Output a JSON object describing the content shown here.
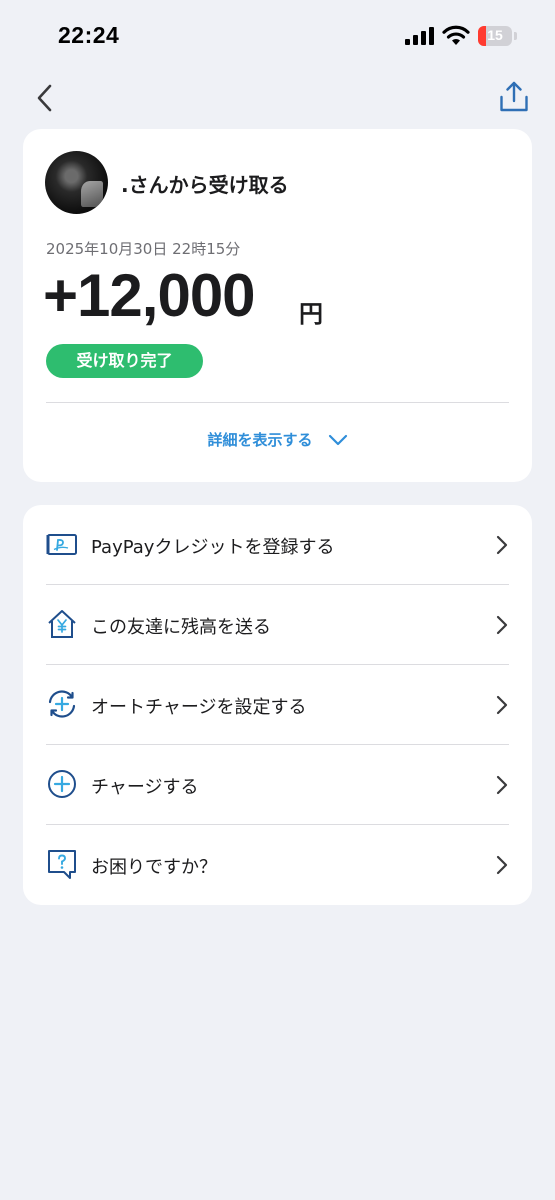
{
  "status_bar": {
    "time": "22:24",
    "battery_level": "15",
    "battery_color": "#ff3b30"
  },
  "nav": {
    "back_icon": "chevron-left-icon",
    "share_icon": "share-icon"
  },
  "transaction": {
    "title": ".さんから受け取る",
    "datetime": "2025年10月30日 22時15分",
    "amount": "+12,000",
    "currency": "円",
    "status": "受け取り完了",
    "status_color": "#2ebd6f",
    "details_label": "詳細を表示する"
  },
  "menu": {
    "items": [
      {
        "label": "PayPayクレジットを登録する",
        "icon": "credit-card-icon"
      },
      {
        "label": "この友達に残高を送る",
        "icon": "yen-house-icon"
      },
      {
        "label": "オートチャージを設定する",
        "icon": "auto-charge-icon"
      },
      {
        "label": "チャージする",
        "icon": "plus-circle-icon"
      },
      {
        "label": "お困りですか？",
        "icon": "help-bubble-icon"
      }
    ]
  },
  "colors": {
    "accent": "#2f8ed9",
    "icon_navy": "#1f4e8c",
    "background": "#eff1f6"
  }
}
